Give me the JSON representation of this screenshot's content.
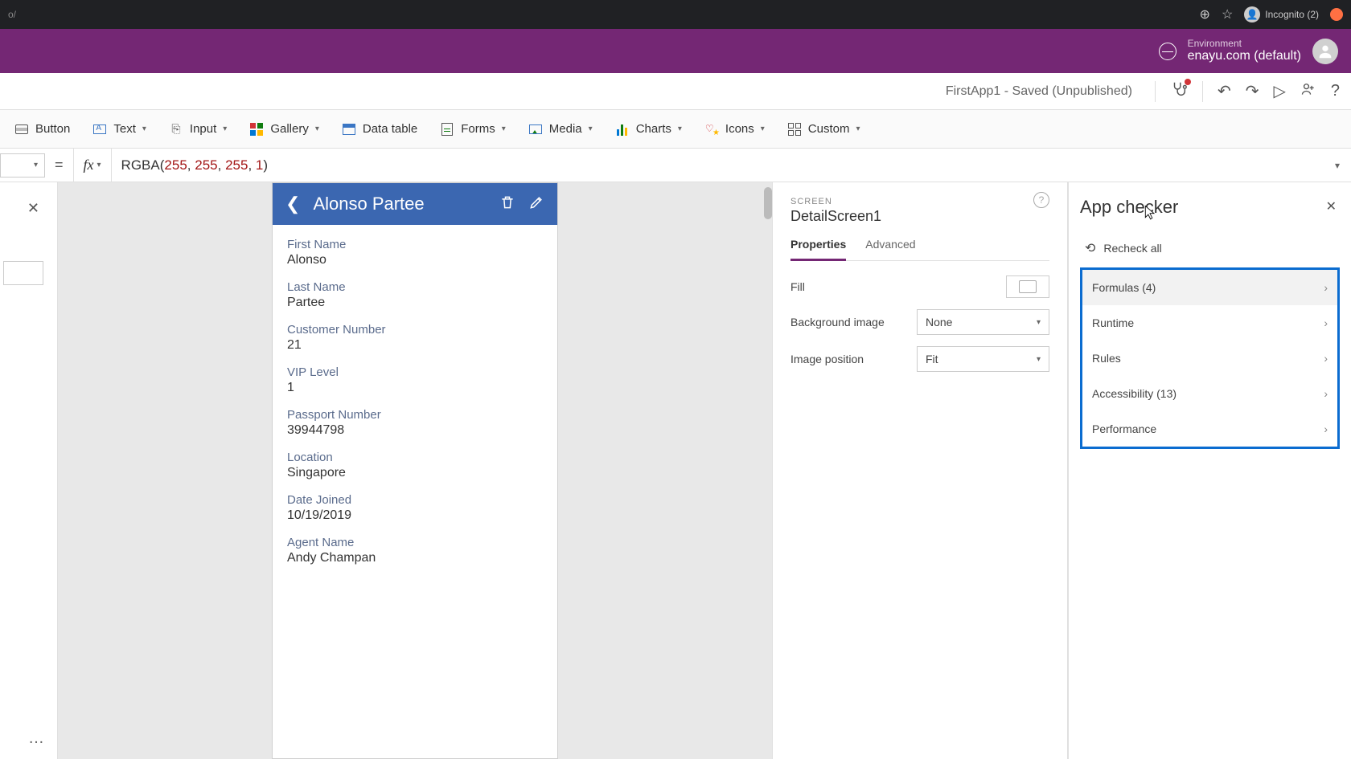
{
  "browser": {
    "url_fragment": "o/",
    "incognito_label": "Incognito (2)"
  },
  "header": {
    "env_label": "Environment",
    "env_name": "enayu.com (default)"
  },
  "commandbar": {
    "app_status": "FirstApp1 - Saved (Unpublished)"
  },
  "ribbon": {
    "button": "Button",
    "text": "Text",
    "input": "Input",
    "gallery": "Gallery",
    "datatable": "Data table",
    "forms": "Forms",
    "media": "Media",
    "charts": "Charts",
    "icons": "Icons",
    "custom": "Custom"
  },
  "formula": {
    "fn": "RGBA",
    "a1": "255",
    "a2": "255",
    "a3": "255",
    "a4": "1"
  },
  "detail": {
    "title": "Alonso Partee",
    "fields": [
      {
        "label": "First Name",
        "value": "Alonso"
      },
      {
        "label": "Last Name",
        "value": "Partee"
      },
      {
        "label": "Customer Number",
        "value": "21"
      },
      {
        "label": "VIP Level",
        "value": "1"
      },
      {
        "label": "Passport Number",
        "value": "39944798"
      },
      {
        "label": "Location",
        "value": "Singapore"
      },
      {
        "label": "Date Joined",
        "value": "10/19/2019"
      },
      {
        "label": "Agent Name",
        "value": "Andy Champan"
      }
    ]
  },
  "props": {
    "screen_label": "SCREEN",
    "screen_name": "DetailScreen1",
    "tab_properties": "Properties",
    "tab_advanced": "Advanced",
    "rows": {
      "fill": "Fill",
      "bg_image": "Background image",
      "bg_image_val": "None",
      "img_pos": "Image position",
      "img_pos_val": "Fit"
    }
  },
  "checker": {
    "title": "App checker",
    "recheck": "Recheck all",
    "categories": {
      "formulas": "Formulas (4)",
      "runtime": "Runtime",
      "rules": "Rules",
      "accessibility": "Accessibility (13)",
      "performance": "Performance"
    }
  }
}
